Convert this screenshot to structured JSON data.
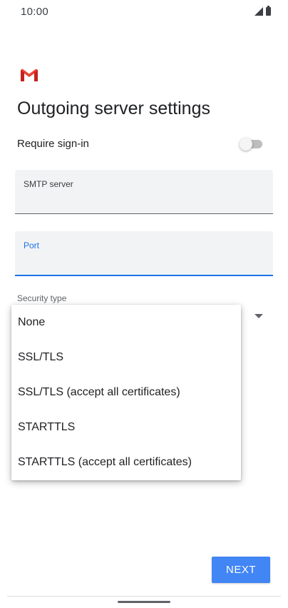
{
  "status_bar": {
    "time": "10:00",
    "icons": [
      "signal-icon",
      "battery-icon"
    ]
  },
  "app": {
    "logo": "gmail-logo-icon",
    "brand_colors": [
      "#EA4335",
      "#C5221F"
    ]
  },
  "page": {
    "title": "Outgoing server settings"
  },
  "require_sign_in": {
    "label": "Require sign-in",
    "enabled": false
  },
  "fields": {
    "smtp_server": {
      "label": "SMTP server",
      "value": ""
    },
    "port": {
      "label": "Port",
      "value": "",
      "focused": true
    }
  },
  "security_type": {
    "label": "Security type",
    "options": [
      "None",
      "SSL/TLS",
      "SSL/TLS (accept all certificates)",
      "STARTTLS",
      "STARTTLS (accept all certificates)"
    ]
  },
  "actions": {
    "next_label": "NEXT"
  },
  "colors": {
    "accent": "#1a73e8",
    "button": "#4285f4"
  }
}
